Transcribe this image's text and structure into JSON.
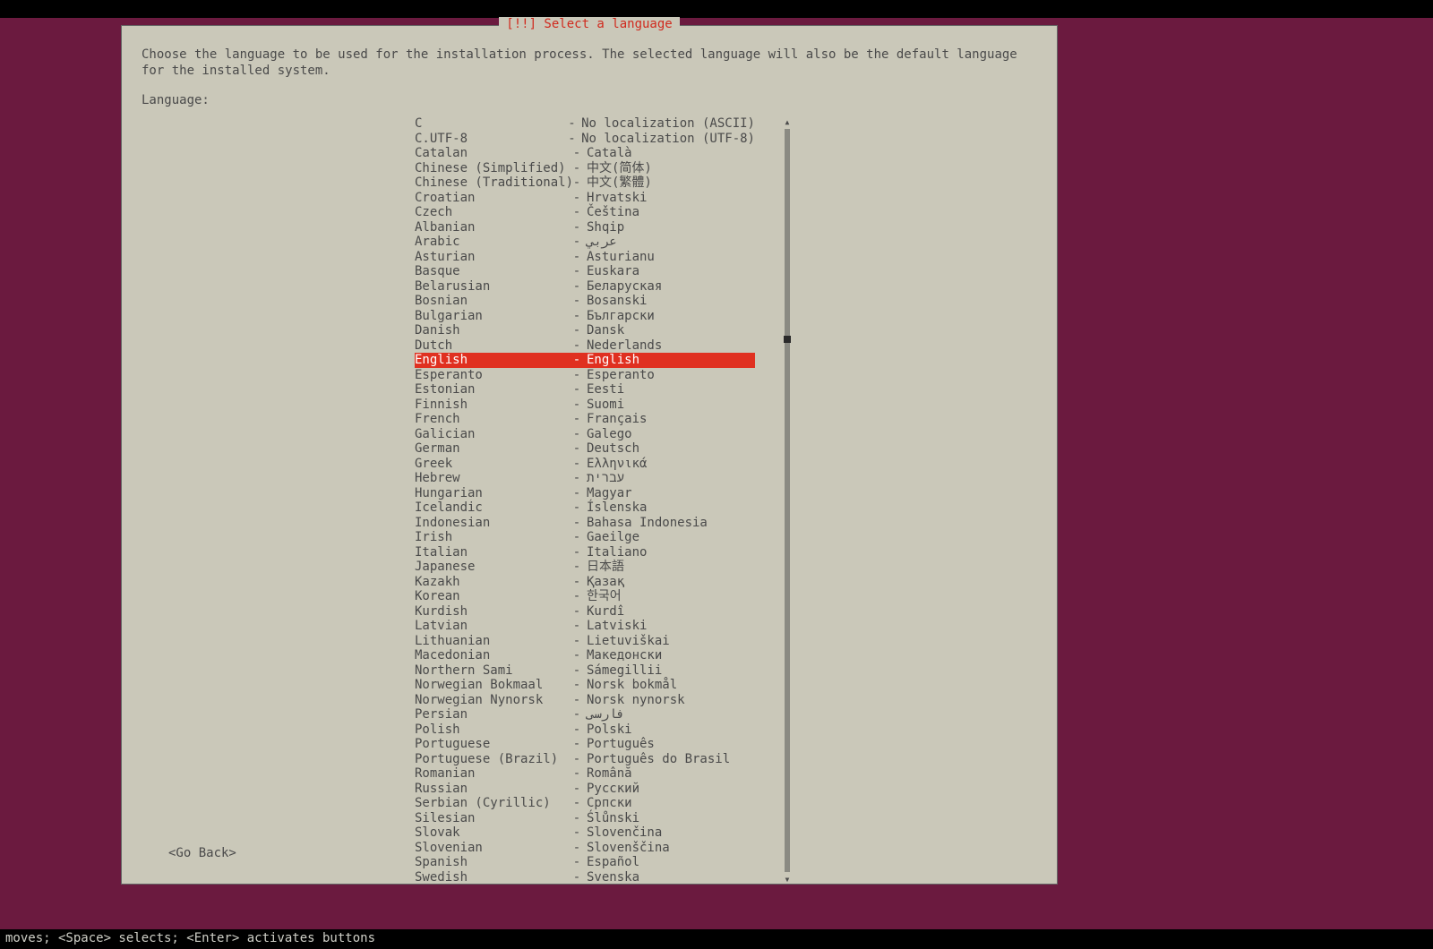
{
  "title": "[!!] Select a language",
  "intro": "Choose the language to be used for the installation process. The selected language will also be the default language for the installed system.",
  "label": "Language:",
  "selected_index": 16,
  "languages": [
    {
      "lang": "C",
      "native": "No localization (ASCII)"
    },
    {
      "lang": "C.UTF-8",
      "native": "No localization (UTF-8)"
    },
    {
      "lang": "Catalan",
      "native": "Català"
    },
    {
      "lang": "Chinese (Simplified)",
      "native": "中文(简体)"
    },
    {
      "lang": "Chinese (Traditional)",
      "native": "中文(繁體)"
    },
    {
      "lang": "Croatian",
      "native": "Hrvatski"
    },
    {
      "lang": "Czech",
      "native": "Čeština"
    },
    {
      "lang": "Albanian",
      "native": "Shqip"
    },
    {
      "lang": "Arabic",
      "native": "عربي"
    },
    {
      "lang": "Asturian",
      "native": "Asturianu"
    },
    {
      "lang": "Basque",
      "native": "Euskara"
    },
    {
      "lang": "Belarusian",
      "native": "Беларуская"
    },
    {
      "lang": "Bosnian",
      "native": "Bosanski"
    },
    {
      "lang": "Bulgarian",
      "native": "Български"
    },
    {
      "lang": "Danish",
      "native": "Dansk"
    },
    {
      "lang": "Dutch",
      "native": "Nederlands"
    },
    {
      "lang": "English",
      "native": "English"
    },
    {
      "lang": "Esperanto",
      "native": "Esperanto"
    },
    {
      "lang": "Estonian",
      "native": "Eesti"
    },
    {
      "lang": "Finnish",
      "native": "Suomi"
    },
    {
      "lang": "French",
      "native": "Français"
    },
    {
      "lang": "Galician",
      "native": "Galego"
    },
    {
      "lang": "German",
      "native": "Deutsch"
    },
    {
      "lang": "Greek",
      "native": "Ελληνικά"
    },
    {
      "lang": "Hebrew",
      "native": "עברית"
    },
    {
      "lang": "Hungarian",
      "native": "Magyar"
    },
    {
      "lang": "Icelandic",
      "native": "Íslenska"
    },
    {
      "lang": "Indonesian",
      "native": "Bahasa Indonesia"
    },
    {
      "lang": "Irish",
      "native": "Gaeilge"
    },
    {
      "lang": "Italian",
      "native": "Italiano"
    },
    {
      "lang": "Japanese",
      "native": "日本語"
    },
    {
      "lang": "Kazakh",
      "native": "Қазақ"
    },
    {
      "lang": "Korean",
      "native": "한국어"
    },
    {
      "lang": "Kurdish",
      "native": "Kurdî"
    },
    {
      "lang": "Latvian",
      "native": "Latviski"
    },
    {
      "lang": "Lithuanian",
      "native": "Lietuviškai"
    },
    {
      "lang": "Macedonian",
      "native": "Македонски"
    },
    {
      "lang": "Northern Sami",
      "native": "Sámegillii"
    },
    {
      "lang": "Norwegian Bokmaal",
      "native": "Norsk bokmål"
    },
    {
      "lang": "Norwegian Nynorsk",
      "native": "Norsk nynorsk"
    },
    {
      "lang": "Persian",
      "native": "فارسی"
    },
    {
      "lang": "Polish",
      "native": "Polski"
    },
    {
      "lang": "Portuguese",
      "native": "Português"
    },
    {
      "lang": "Portuguese (Brazil)",
      "native": "Português do Brasil"
    },
    {
      "lang": "Romanian",
      "native": "Română"
    },
    {
      "lang": "Russian",
      "native": "Русский"
    },
    {
      "lang": "Serbian (Cyrillic)",
      "native": "Српски"
    },
    {
      "lang": "Silesian",
      "native": "Ślůnski"
    },
    {
      "lang": "Slovak",
      "native": "Slovenčina"
    },
    {
      "lang": "Slovenian",
      "native": "Slovenščina"
    },
    {
      "lang": "Spanish",
      "native": "Español"
    },
    {
      "lang": "Swedish",
      "native": "Svenska"
    }
  ],
  "go_back": "<Go Back>",
  "footer": "moves; <Space> selects; <Enter> activates buttons"
}
